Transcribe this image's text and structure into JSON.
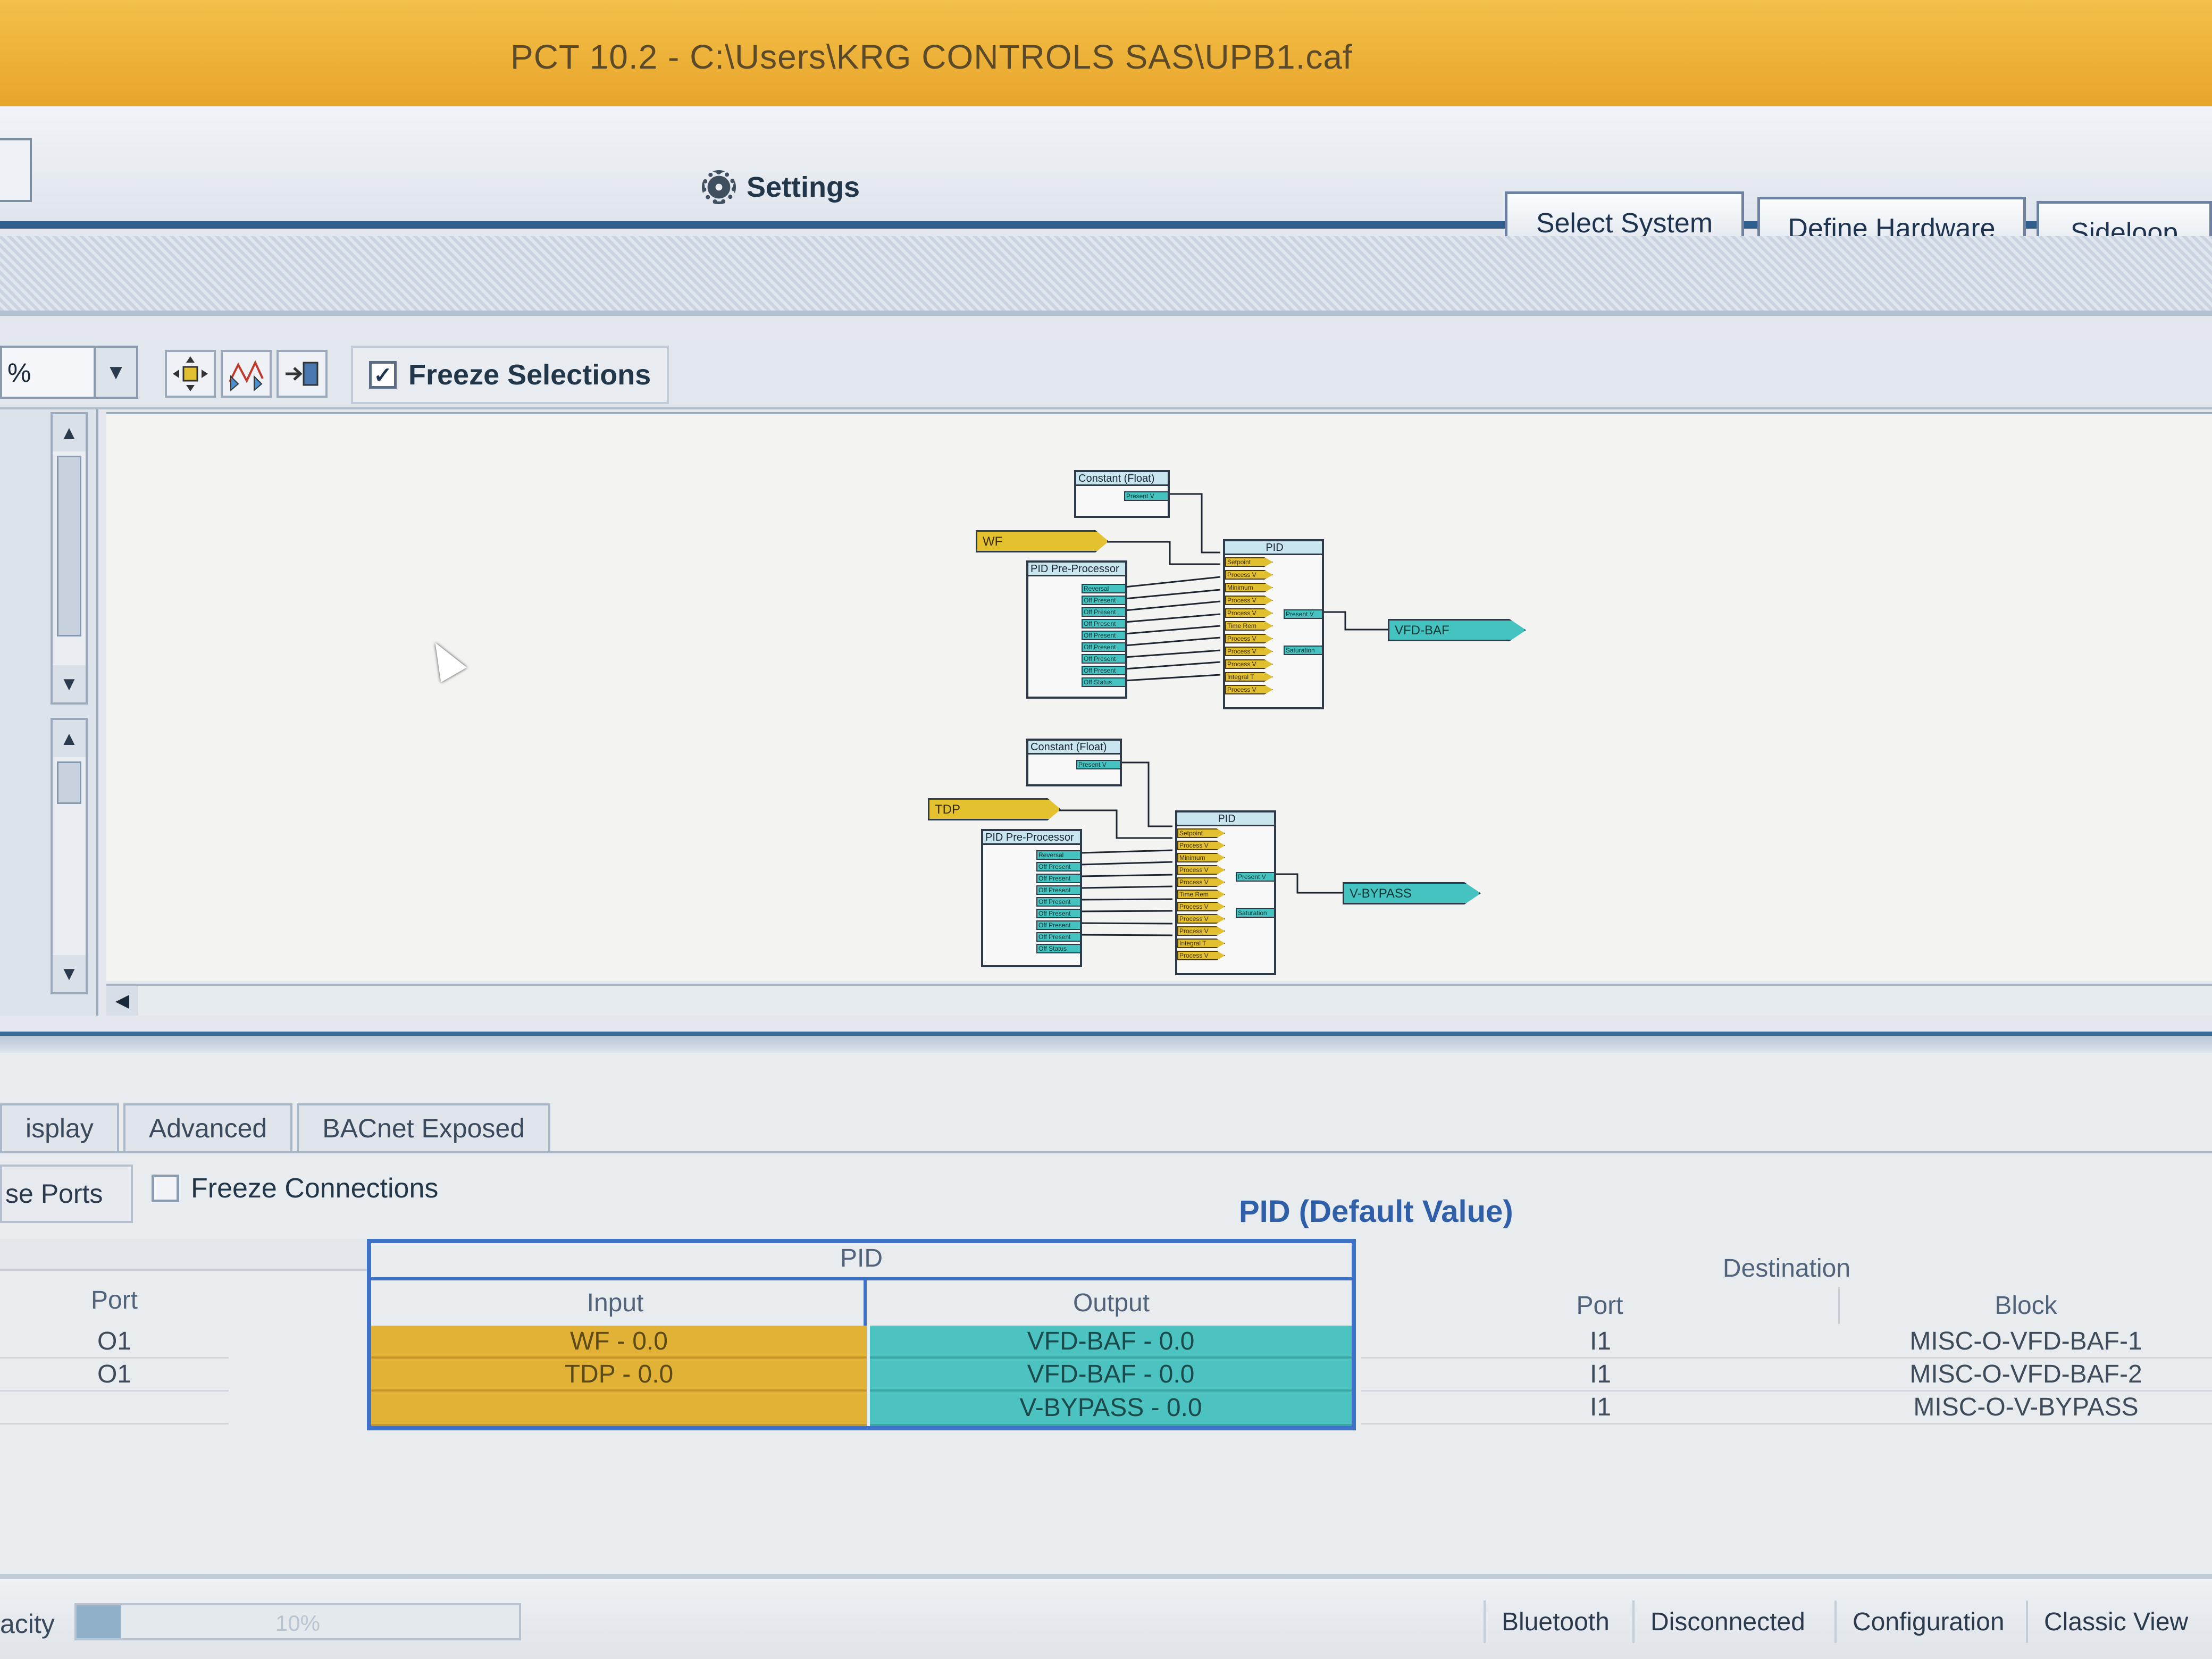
{
  "window": {
    "title": "PCT 10.2 - C:\\Users\\KRG CONTROLS SAS\\UPB1.caf"
  },
  "header": {
    "settings_label": "Settings",
    "buttons": {
      "select_system": "Select System",
      "define_hardware": "Define Hardware",
      "sideloop": "Sideloop"
    }
  },
  "diagram_toolbar": {
    "zoom_value": "%",
    "freeze_selections_label": "Freeze Selections",
    "freeze_selections_checked": true
  },
  "diagram": {
    "loop1": {
      "constant_title": "Constant (Float)",
      "constant_port": "Present V",
      "input_tag": "WF",
      "preproc_title": "PID Pre-Processor",
      "preproc_ports": [
        "Reversal",
        "Off Present",
        "Off Present",
        "Off Present",
        "Off Present",
        "Off Present",
        "Off Present",
        "Off Present",
        "Off Status"
      ],
      "pid_title": "PID",
      "pid_ports": [
        "Setpoint",
        "Process V",
        "Minimum",
        "Process V",
        "Process V",
        "Time Rem",
        "Process V",
        "Process V",
        "Process V",
        "Integral T",
        "Process V"
      ],
      "pid_outputs": [
        "Present V",
        "Saturation"
      ],
      "output_tag": "VFD-BAF"
    },
    "loop2": {
      "constant_title": "Constant (Float)",
      "constant_port": "Present V",
      "input_tag": "TDP",
      "preproc_title": "PID Pre-Processor",
      "preproc_ports": [
        "Reversal",
        "Off Present",
        "Off Present",
        "Off Present",
        "Off Present",
        "Off Present",
        "Off Present",
        "Off Present",
        "Off Status"
      ],
      "pid_title": "PID",
      "pid_ports": [
        "Setpoint",
        "Process V",
        "Minimum",
        "Process V",
        "Process V",
        "Time Rem",
        "Process V",
        "Process V",
        "Process V",
        "Integral T",
        "Process V"
      ],
      "pid_outputs": [
        "Present V",
        "Saturation"
      ],
      "output_tag": "V-BYPASS"
    }
  },
  "tabs": [
    "isplay",
    "Advanced",
    "BACnet Exposed"
  ],
  "options": {
    "ports_button": "se Ports",
    "freeze_connections_label": "Freeze Connections",
    "freeze_connections_checked": false
  },
  "table_title": "PID (Default Value)",
  "connections": {
    "group_header": "PID",
    "source_port_header": "Port",
    "input_header": "Input",
    "output_header": "Output",
    "destination_header": "Destination",
    "dest_port_header": "Port",
    "dest_block_header": "Block",
    "rows": [
      {
        "source_port": "O1",
        "input": "WF - 0.0",
        "output": "VFD-BAF - 0.0",
        "dest_port": "I1",
        "dest_block": "MISC-O-VFD-BAF-1"
      },
      {
        "source_port": "O1",
        "input": "TDP - 0.0",
        "output": "VFD-BAF - 0.0",
        "dest_port": "I1",
        "dest_block": "MISC-O-VFD-BAF-2"
      },
      {
        "source_port": "",
        "input": "",
        "output": "V-BYPASS - 0.0",
        "dest_port": "I1",
        "dest_block": "MISC-O-V-BYPASS"
      }
    ]
  },
  "status_bar": {
    "capacity_label": "acity",
    "capacity_percent": 10,
    "capacity_text": "10%",
    "items": [
      "Bluetooth",
      "Disconnected",
      "Configuration",
      "Classic View"
    ]
  }
}
